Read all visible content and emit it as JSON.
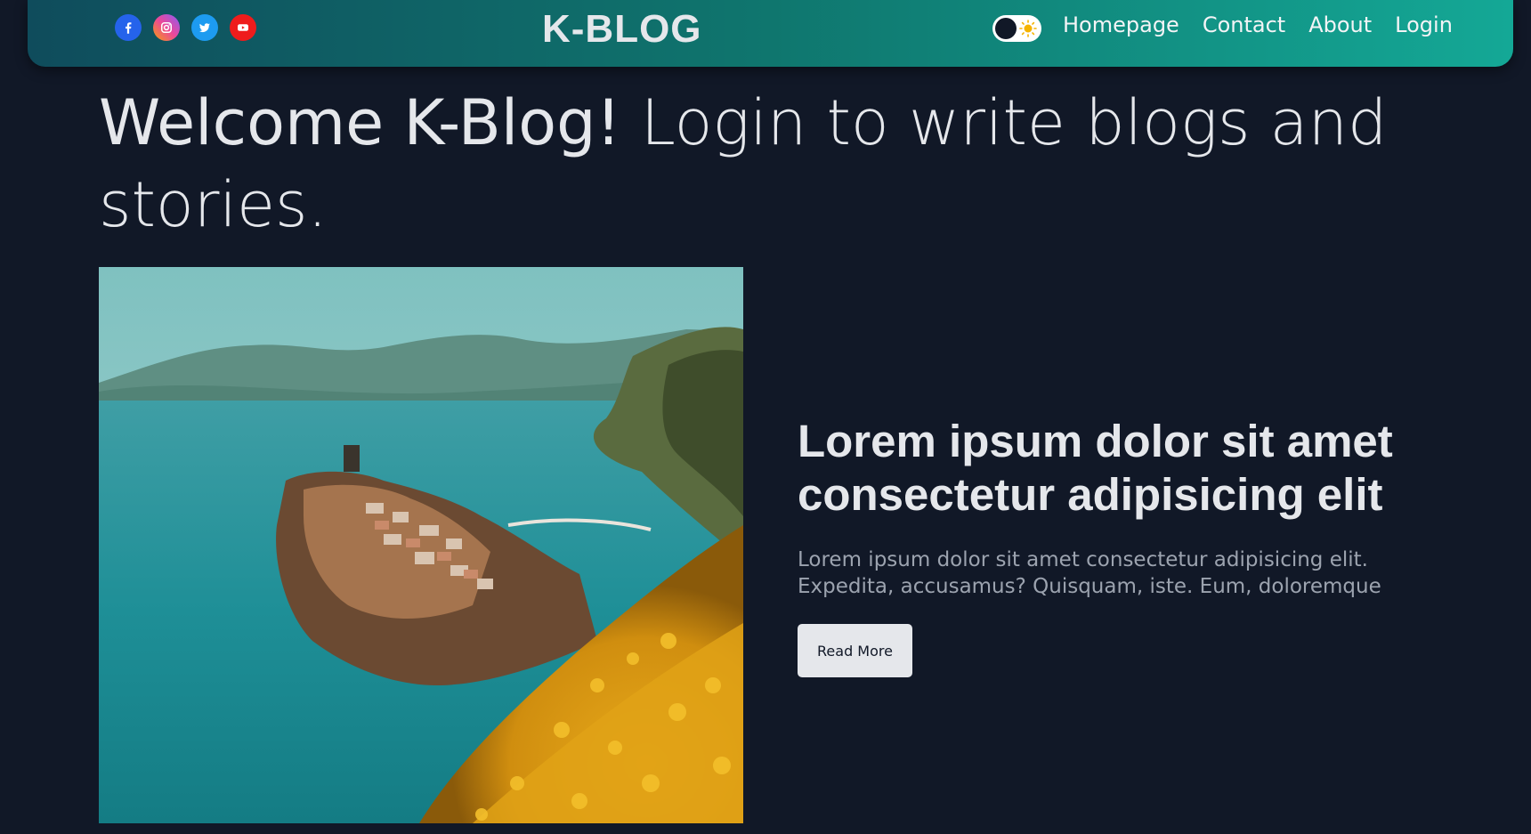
{
  "header": {
    "brand": "K-BLOG",
    "social_icons": [
      "facebook-icon",
      "instagram-icon",
      "twitter-icon",
      "youtube-icon"
    ],
    "nav_links": [
      {
        "label": "Homepage"
      },
      {
        "label": "Contact"
      },
      {
        "label": "About"
      },
      {
        "label": "Login"
      }
    ]
  },
  "hero": {
    "title_strong": "Welcome K-Blog!",
    "title_rest": " Login to write blogs and stories."
  },
  "featured_post": {
    "title": "Lorem ipsum dolor sit amet consectetur adipisicing elit",
    "excerpt": "Lorem ipsum dolor sit amet consectetur adipisicing elit. Expedita, accusamus? Quisquam, iste. Eum, doloremque",
    "button_label": "Read More"
  },
  "colors": {
    "background": "#111827",
    "nav_gradient_start": "#0f4c5c",
    "nav_gradient_end": "#14a896",
    "text": "#e5e7eb",
    "muted_text": "#9ca3af",
    "button_bg": "#e5e7eb"
  }
}
